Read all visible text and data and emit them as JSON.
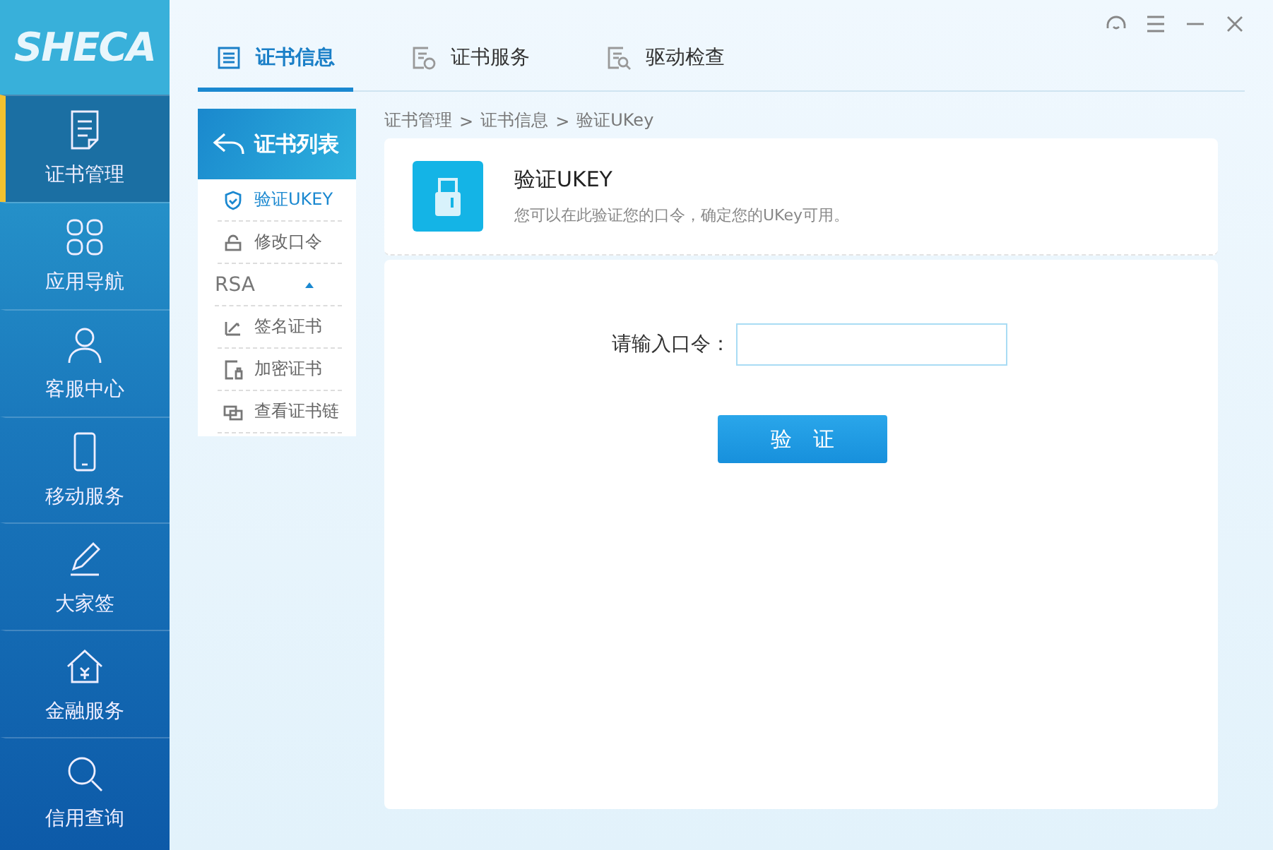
{
  "logo": {
    "text": "SHECA"
  },
  "sidebar": {
    "items": [
      {
        "label": "证书管理",
        "selected": true
      },
      {
        "label": "应用导航",
        "selected": false
      },
      {
        "label": "客服中心",
        "selected": false
      },
      {
        "label": "移动服务",
        "selected": false
      },
      {
        "label": "大家签",
        "selected": false
      },
      {
        "label": "金融服务",
        "selected": false
      },
      {
        "label": "信用查询",
        "selected": false
      }
    ]
  },
  "tabs": [
    {
      "label": "证书信息",
      "selected": true
    },
    {
      "label": "证书服务",
      "selected": false
    },
    {
      "label": "驱动检查",
      "selected": false
    }
  ],
  "cert_list": {
    "title": "证书列表",
    "items": [
      {
        "kind": "item",
        "label": "验证UKEY",
        "selected": true
      },
      {
        "kind": "item",
        "label": "修改口令",
        "selected": false
      },
      {
        "kind": "group",
        "label": "RSA",
        "expanded": true,
        "children": [
          {
            "kind": "item",
            "label": "签名证书",
            "selected": false
          },
          {
            "kind": "item",
            "label": "加密证书",
            "selected": false
          },
          {
            "kind": "item",
            "label": "查看证书链",
            "selected": false
          }
        ]
      }
    ]
  },
  "breadcrumb": [
    "证书管理",
    "证书信息",
    "验证UKey"
  ],
  "breadcrumb_separator": ">",
  "panel": {
    "title": "验证UKEY",
    "description": "您可以在此验证您的口令，确定您的UKey可用。",
    "field_label": "请输入口令：",
    "button": "验　证"
  }
}
